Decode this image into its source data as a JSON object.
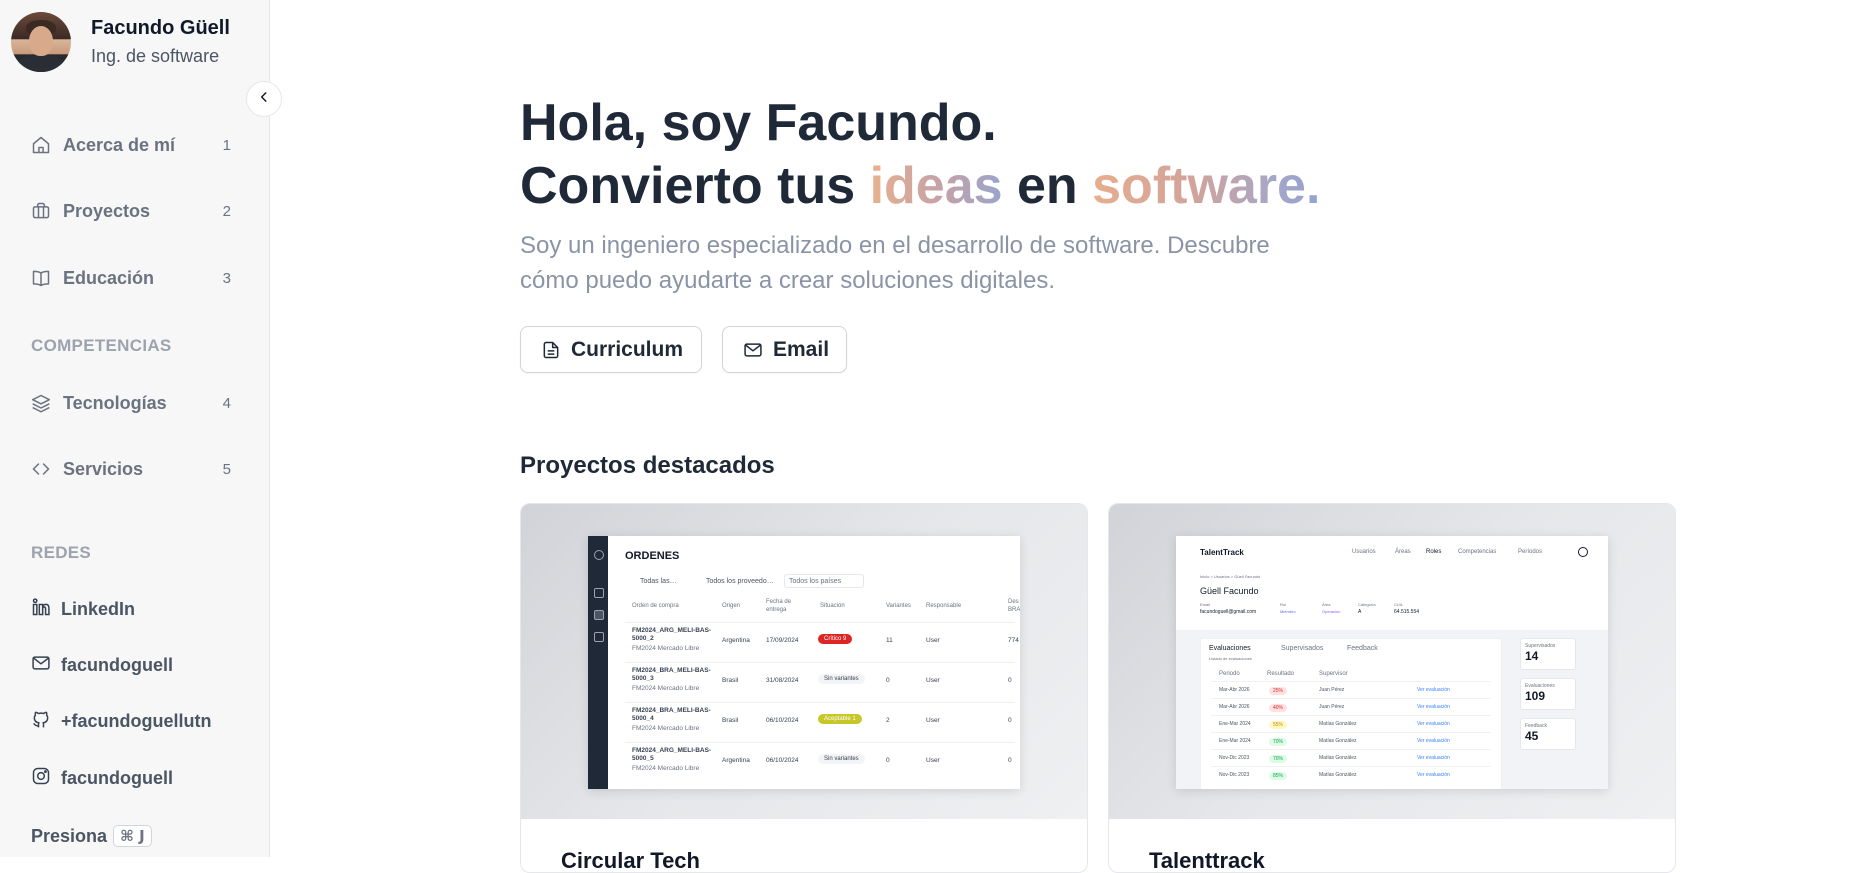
{
  "profile": {
    "name": "Facundo Güell",
    "role": "Ing. de software"
  },
  "sidebar": {
    "nav": [
      {
        "label": "Acerca de mí",
        "shortcut": "1",
        "icon": "home-icon"
      },
      {
        "label": "Proyectos",
        "shortcut": "2",
        "icon": "briefcase-icon"
      },
      {
        "label": "Educación",
        "shortcut": "3",
        "icon": "book-icon"
      }
    ],
    "competencias_title": "COMPETENCIAS",
    "competencias": [
      {
        "label": "Tecnologías",
        "shortcut": "4",
        "icon": "layers-icon"
      },
      {
        "label": "Servicios",
        "shortcut": "5",
        "icon": "code-icon"
      }
    ],
    "redes_title": "REDES",
    "redes": [
      {
        "label": "LinkedIn",
        "icon": "linkedin-icon"
      },
      {
        "label": "facundoguell",
        "icon": "mail-icon"
      },
      {
        "label": "+facundoguellutn",
        "icon": "github-icon"
      },
      {
        "label": "facundoguell",
        "icon": "instagram-icon"
      }
    ],
    "press_label": "Presiona",
    "press_key": "⌘ J"
  },
  "hero": {
    "line1": "Hola, soy Facundo.",
    "line2_a": "Convierto tus ",
    "line2_ideas": "ideas",
    "line2_b": " en ",
    "line2_software": "software.",
    "subtitle": "Soy un ingeniero especializado en el desarrollo de software. Descubre cómo puedo ayudarte a crear soluciones digitales.",
    "btn_cv": "Curriculum",
    "btn_email": "Email"
  },
  "featured": {
    "title": "Proyectos destacados",
    "cards": [
      {
        "title": "Circular Tech"
      },
      {
        "title": "Talenttrack"
      }
    ]
  },
  "mini1": {
    "title": "ORDENES",
    "filters": [
      "Todas las…",
      "Todos los proveedo…",
      "Todos los países"
    ],
    "headers": [
      "Orden de compra",
      "Origen",
      "Fecha de entrega",
      "Situación",
      "Variantes",
      "Responsable",
      "Des BRA"
    ],
    "rows": [
      {
        "order": "FM2024_ARG_MELI-BAS-5000_2",
        "sub": "FM2024 Mercado Libre",
        "origin": "Argentina",
        "date": "17/09/2024",
        "status": "Crítico 9",
        "variants": "11",
        "resp": "User",
        "last": "774"
      },
      {
        "order": "FM2024_BRA_MELI-BAS-5000_3",
        "sub": "FM2024 Mercado Libre",
        "origin": "Brasil",
        "date": "31/08/2024",
        "status": "Sin variantes",
        "variants": "0",
        "resp": "User",
        "last": "0"
      },
      {
        "order": "FM2024_BRA_MELI-BAS-5000_4",
        "sub": "FM2024 Mercado Libre",
        "origin": "Brasil",
        "date": "06/10/2024",
        "status": "Aceptable 1",
        "variants": "2",
        "resp": "User",
        "last": "0"
      },
      {
        "order": "FM2024_ARG_MELI-BAS-5000_5",
        "sub": "FM2024 Mercado Libre",
        "origin": "Argentina",
        "date": "06/10/2024",
        "status": "Sin variantes",
        "variants": "0",
        "resp": "User",
        "last": "0"
      }
    ]
  },
  "mini2": {
    "brand": "TalentTrack",
    "menu": [
      "Usuarios",
      "Áreas",
      "Roles",
      "Competencias",
      "Períodos"
    ],
    "breadcrumb": "Inicio > Usuarios > Güell Facundo",
    "user_name": "Güell Facundo",
    "email_label": "Email",
    "email": "facundoguell@gmail.com",
    "rol_label": "Rol",
    "rol": "Miembro",
    "area_label": "Área",
    "area": "Operación",
    "cat_label": "Categoría",
    "cat": "A",
    "cuil_label": "CUIL",
    "cuil": "64.515.554",
    "tabs": [
      "Evaluaciones",
      "Supervisados",
      "Feedback"
    ],
    "panel_sub": "Listado de evaluaciones",
    "cols": [
      "Periodo",
      "Resultado",
      "Supervisor"
    ],
    "rows": [
      {
        "period": "Mar-Abr 2026",
        "result": "25%",
        "sup": "Juan Pérez",
        "link": "Ver evaluación"
      },
      {
        "period": "Mar-Abr 2026",
        "result": "40%",
        "sup": "Juan Pérez",
        "link": "Ver evaluación"
      },
      {
        "period": "Ene-Mar 2024",
        "result": "55%",
        "sup": "Matías González",
        "link": "Ver evaluación"
      },
      {
        "period": "Ene-Mar 2024",
        "result": "70%",
        "sup": "Matías González",
        "link": "Ver evaluación"
      },
      {
        "period": "Nov-Dic 2023",
        "result": "70%",
        "sup": "Matías González",
        "link": "Ver evaluación"
      },
      {
        "period": "Nov-Dic 2023",
        "result": "85%",
        "sup": "Matías González",
        "link": "Ver evaluación"
      }
    ],
    "stats": [
      {
        "label": "Supervisados",
        "value": "14"
      },
      {
        "label": "Evaluaciones",
        "value": "109"
      },
      {
        "label": "Feedback",
        "value": "45"
      }
    ]
  }
}
